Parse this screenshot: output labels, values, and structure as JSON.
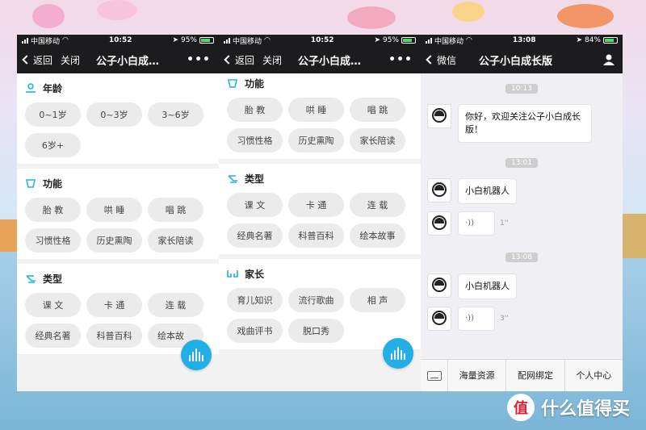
{
  "status_left": [
    {
      "carrier": "中国移动",
      "time": "10:52",
      "battery": "95%"
    },
    {
      "carrier": "中国移动",
      "time": "10:52",
      "battery": "95%"
    },
    {
      "carrier": "中国移动",
      "time": "13:08",
      "battery": "84%"
    }
  ],
  "screen1": {
    "nav": {
      "back": "返回",
      "close": "关闭",
      "title": "公子小白成…",
      "more": "•••"
    },
    "sections": [
      {
        "title": "年龄",
        "icon": "age-icon",
        "chips": [
          "0~1岁",
          "0~3岁",
          "3~6岁",
          "6岁+"
        ]
      },
      {
        "title": "功能",
        "icon": "function-icon",
        "chips": [
          "胎 教",
          "哄 睡",
          "唱 跳",
          "习惯性格",
          "历史熏陶",
          "家长陪读"
        ]
      },
      {
        "title": "类型",
        "icon": "type-icon",
        "chips": [
          "课 文",
          "卡 通",
          "连 载",
          "经典名著",
          "科普百科",
          "绘本故"
        ]
      }
    ]
  },
  "screen2": {
    "nav": {
      "back": "返回",
      "close": "关闭",
      "title": "公子小白成…",
      "more": "•••"
    },
    "sections": [
      {
        "title": "功能",
        "icon": "function-icon",
        "chips": [
          "胎 教",
          "哄 睡",
          "唱 跳",
          "习惯性格",
          "历史熏陶",
          "家长陪读"
        ]
      },
      {
        "title": "类型",
        "icon": "type-icon",
        "chips": [
          "课 文",
          "卡 通",
          "连 载",
          "经典名著",
          "科普百科",
          "绘本故事"
        ]
      },
      {
        "title": "家长",
        "icon": "parent-icon",
        "chips": [
          "育儿知识",
          "流行歌曲",
          "相 声",
          "戏曲评书",
          "脱口秀"
        ]
      }
    ]
  },
  "screen3": {
    "nav": {
      "back": "微信",
      "title": "公子小白成长版"
    },
    "timestamps": [
      "10:13",
      "13:01",
      "13:08"
    ],
    "messages": {
      "welcome": "你好，欢迎关注公子小白成长版！",
      "robot1": "小白机器人",
      "voice1_duration": "1''",
      "robot2": "小白机器人",
      "voice2_duration": "3''"
    },
    "tabs": [
      "海量资源",
      "配网绑定",
      "个人中心"
    ]
  },
  "watermark": {
    "logo": "值",
    "text": "什么值得买"
  },
  "colors": {
    "accent": "#24aee6",
    "navbar": "#1c1c1e",
    "chip": "#ebebeb"
  }
}
